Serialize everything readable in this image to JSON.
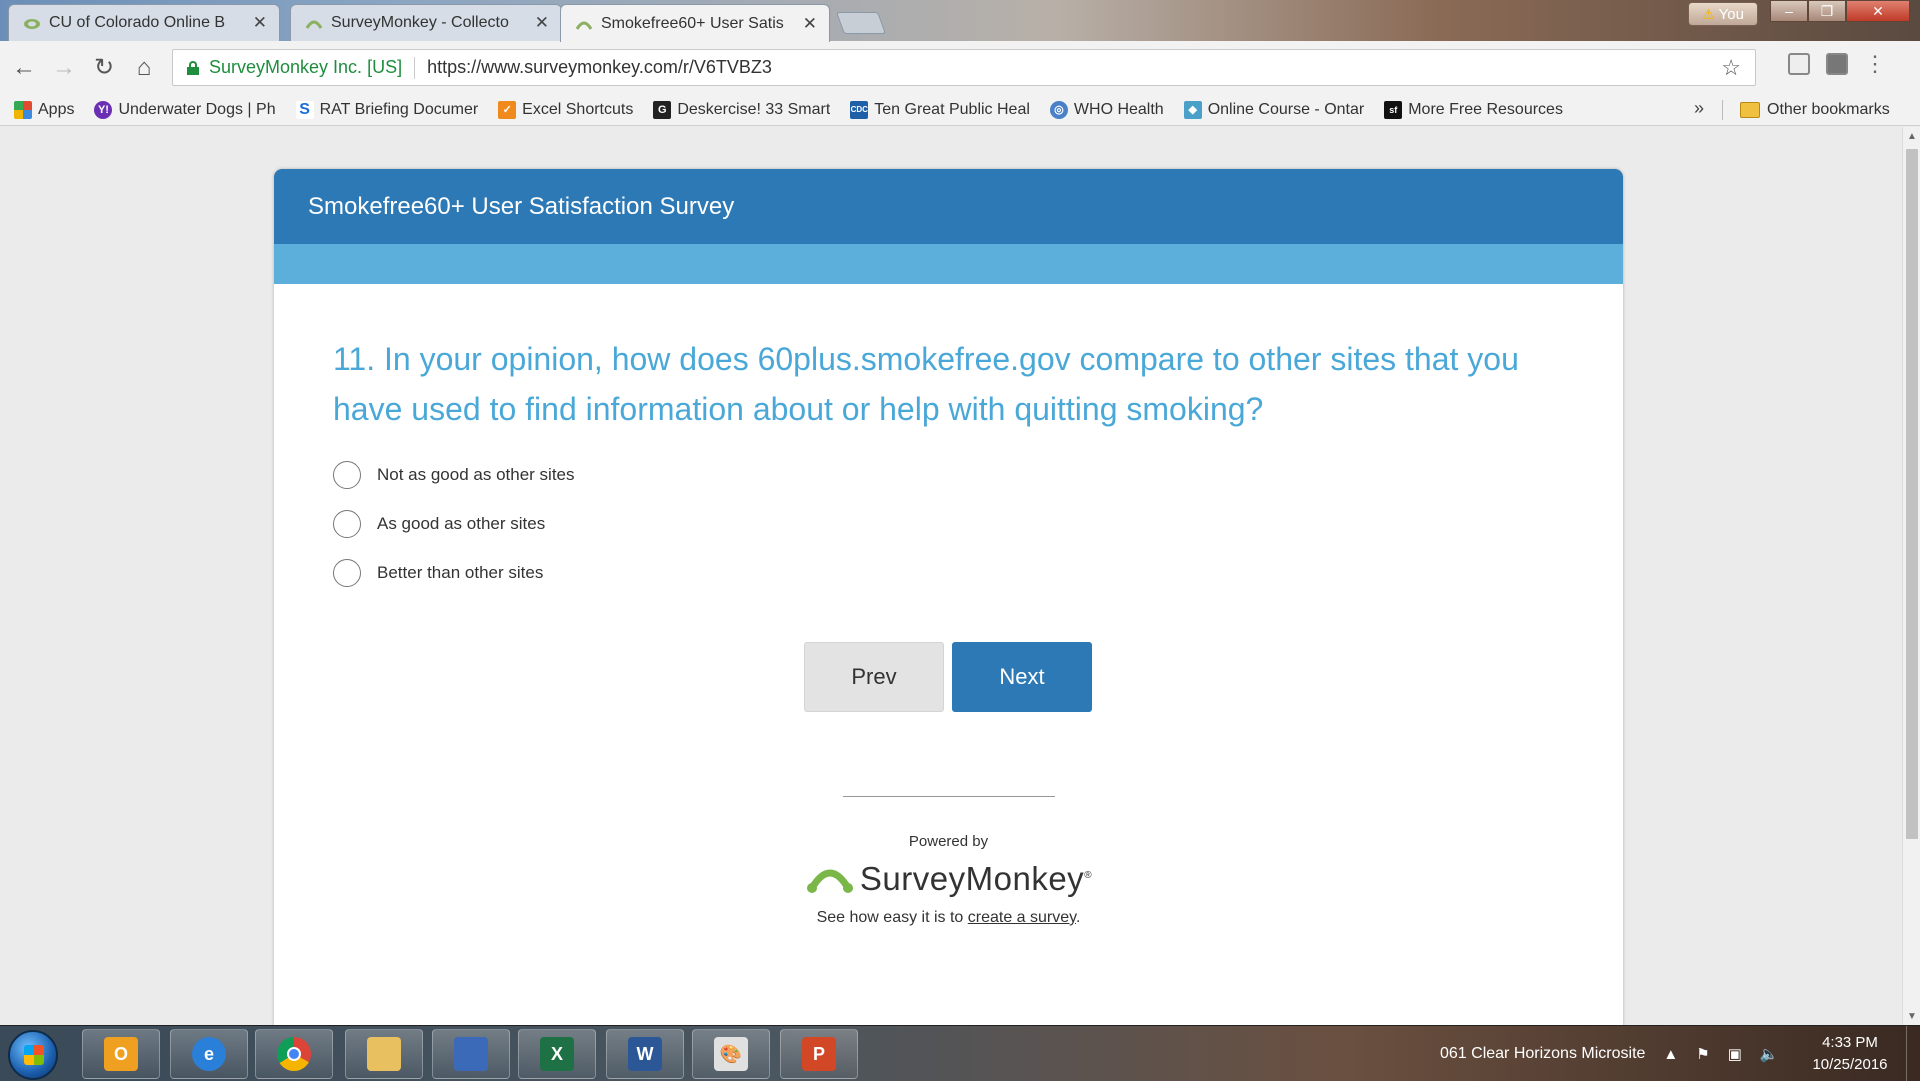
{
  "browser": {
    "tabs": [
      {
        "title": "CU of Colorado Online B",
        "active": false
      },
      {
        "title": "SurveyMonkey - Collecto",
        "active": false
      },
      {
        "title": "Smokefree60+ User Satis",
        "active": true
      }
    ],
    "profile_label": "You",
    "window_buttons": {
      "minimize": "–",
      "maximize": "❐",
      "close": "✕"
    },
    "nav": {
      "back": "←",
      "forward": "→",
      "reload": "↻",
      "home": "⌂"
    },
    "address": {
      "security_label": "SurveyMonkey Inc. [US]",
      "url": "https://www.surveymonkey.com/r/V6TVBZ3"
    },
    "bookmarks": [
      {
        "label": "Apps",
        "color": "#e04a2f"
      },
      {
        "label": "Underwater Dogs | Ph",
        "color": "#6b2fb3"
      },
      {
        "label": "RAT Briefing Documer",
        "color": "#1a6ed8"
      },
      {
        "label": "Excel Shortcuts",
        "color": "#f08a1c"
      },
      {
        "label": "Deskercise! 33 Smart",
        "color": "#222222"
      },
      {
        "label": "Ten Great Public Heal",
        "color": "#1f5fa8"
      },
      {
        "label": "WHO Health",
        "color": "#4a80c8"
      },
      {
        "label": "Online Course - Ontar",
        "color": "#4aa0c8"
      },
      {
        "label": "More Free Resources",
        "color": "#111111"
      }
    ],
    "bookmarks_overflow": "»",
    "other_bookmarks": "Other bookmarks"
  },
  "survey": {
    "title": "Smokefree60+ User Satisfaction Survey",
    "question": "11. In your opinion, how does 60plus.smokefree.gov compare to other sites that you have used to find information about or help with quitting smoking?",
    "options": [
      "Not as good as other sites",
      "As good as other sites",
      "Better than other sites"
    ],
    "prev_label": "Prev",
    "next_label": "Next",
    "powered_by": "Powered by",
    "brand": "SurveyMonkey",
    "brand_mark": "®",
    "tagline_prefix": "See how easy it is to ",
    "tagline_link": "create a survey",
    "tagline_suffix": ".",
    "colors": {
      "header": "#2d79b5",
      "band": "#5caedb",
      "question": "#4aa8d8"
    }
  },
  "taskbar": {
    "apps": [
      "outlook-icon",
      "internet-explorer-icon",
      "chrome-icon",
      "file-explorer-icon",
      "remote-desktop-icon",
      "excel-icon",
      "word-icon",
      "paint-icon",
      "powerpoint-icon"
    ],
    "tray_label": "061 Clear Horizons Microsite",
    "time": "4:33 PM",
    "date": "10/25/2016"
  }
}
